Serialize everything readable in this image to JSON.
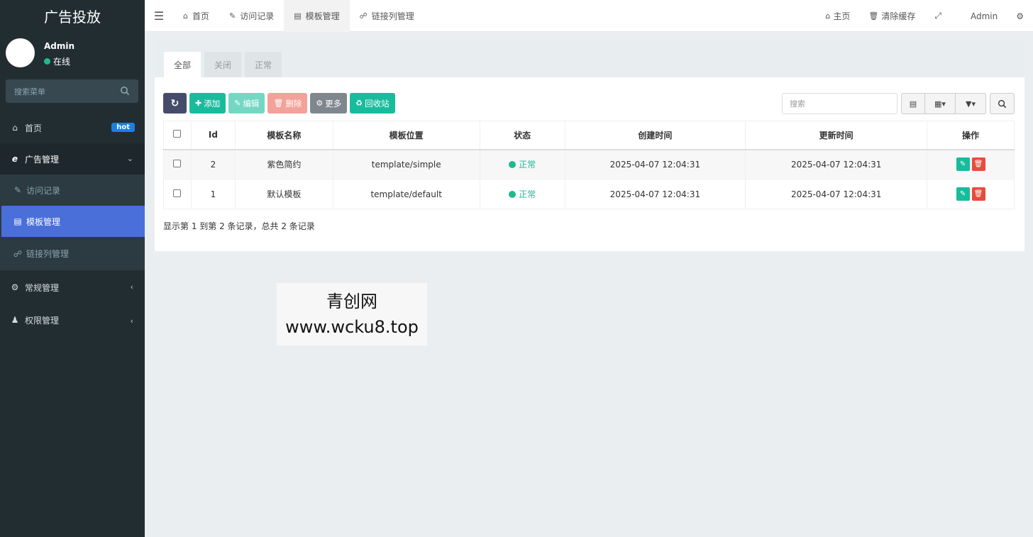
{
  "brand": "广告投放",
  "user": {
    "name": "Admin",
    "status": "在线"
  },
  "side_search": {
    "placeholder": "搜索菜单"
  },
  "menu": {
    "home": {
      "label": "首页",
      "badge": "hot"
    },
    "ad_mgmt": {
      "label": "广告管理"
    },
    "visit_log": {
      "label": "访问记录"
    },
    "template_mgmt": {
      "label": "模板管理"
    },
    "link_list": {
      "label": "链接列管理"
    },
    "general": {
      "label": "常规管理"
    },
    "permission": {
      "label": "权限管理"
    }
  },
  "topnav": {
    "tabs": [
      "首页",
      "访问记录",
      "模板管理",
      "链接列管理"
    ],
    "right": {
      "home": "主页",
      "clear_cache": "清除缓存",
      "admin": "Admin"
    }
  },
  "panel_tabs": [
    "全部",
    "关闭",
    "正常"
  ],
  "toolbar": {
    "add": "添加",
    "edit": "编辑",
    "delete": "删除",
    "more": "更多",
    "recycle": "回收站"
  },
  "table_search": {
    "placeholder": "搜索"
  },
  "table": {
    "headers": [
      "Id",
      "模板名称",
      "模板位置",
      "状态",
      "创建时间",
      "更新时间",
      "操作"
    ],
    "rows": [
      {
        "id": "2",
        "name": "紫色简约",
        "path": "template/simple",
        "status": "正常",
        "created": "2025-04-07 12:04:31",
        "updated": "2025-04-07 12:04:31"
      },
      {
        "id": "1",
        "name": "默认模板",
        "path": "template/default",
        "status": "正常",
        "created": "2025-04-07 12:04:31",
        "updated": "2025-04-07 12:04:31"
      }
    ]
  },
  "pager_info": "显示第 1 到第 2 条记录，总共 2 条记录",
  "watermark": {
    "line1": "青创网",
    "line2": "www.wcku8.top"
  },
  "colors": {
    "sidebar": "#222d32",
    "active": "#4a6fd9",
    "primary": "#18bc9c",
    "danger": "#e74c3c"
  }
}
